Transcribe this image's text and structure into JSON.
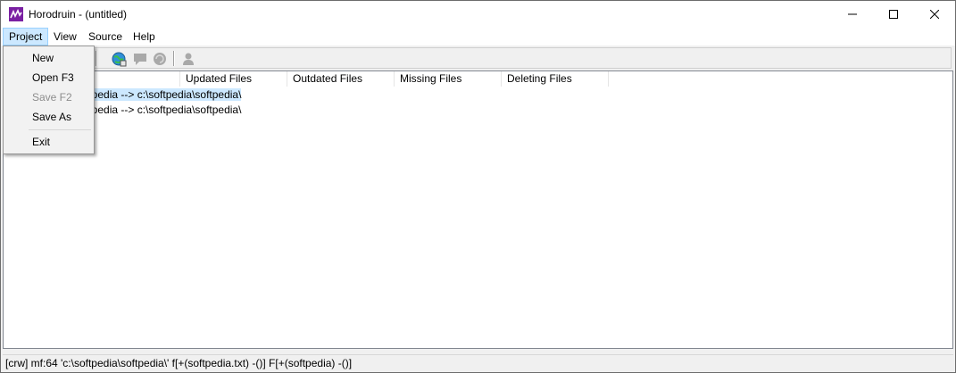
{
  "window": {
    "title": "Horodruin - (untitled)",
    "accent_icon_color": "#7a1fa2"
  },
  "menubar": {
    "items": [
      "Project",
      "View",
      "Source",
      "Help"
    ]
  },
  "project_menu": {
    "items": [
      {
        "label": "New",
        "enabled": true
      },
      {
        "label": "Open F3",
        "enabled": true
      },
      {
        "label": "Save F2",
        "enabled": false
      },
      {
        "label": "Save As",
        "enabled": true
      },
      {
        "label": "Exit",
        "enabled": true
      }
    ]
  },
  "toolbar": {
    "icons": [
      "globe-refresh-icon",
      "comment-icon",
      "refresh-icon",
      "user-icon"
    ]
  },
  "list": {
    "columns": [
      "Updated Files",
      "Outdated Files",
      "Missing Files",
      "Deleting Files"
    ],
    "rows": [
      {
        "text": "ftpedia  --> c:\\softpedia\\softpedia\\",
        "selected": true
      },
      {
        "text": "ftpedia  --> c:\\softpedia\\softpedia\\",
        "selected": false
      }
    ]
  },
  "statusbar": {
    "text": "[crw] mf:64 'c:\\softpedia\\softpedia\\' f[+(softpedia.txt) -()] F[+(softpedia) -()]"
  }
}
